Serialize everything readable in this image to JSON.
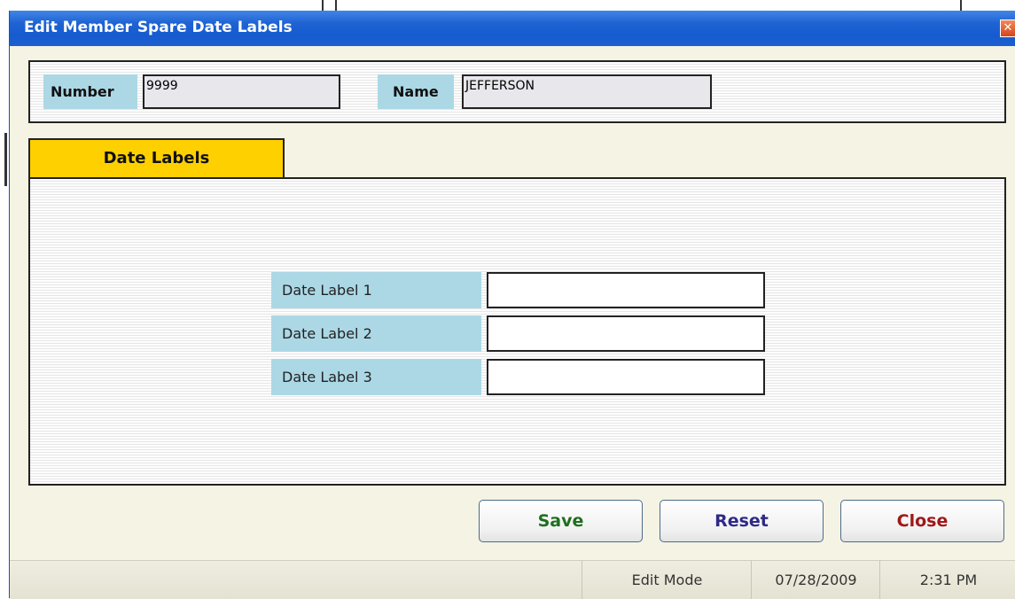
{
  "window": {
    "title": "Edit Member Spare Date Labels",
    "close_glyph": "✕"
  },
  "header": {
    "number_label": "Number",
    "number_value": "9999",
    "name_label": "Name",
    "name_value": "JEFFERSON"
  },
  "tabs": [
    {
      "label": "Date Labels",
      "active": true
    }
  ],
  "fields": [
    {
      "label": "Date Label 1",
      "value": ""
    },
    {
      "label": "Date Label 2",
      "value": ""
    },
    {
      "label": "Date Label 3",
      "value": ""
    }
  ],
  "buttons": {
    "save": "Save",
    "reset": "Reset",
    "close": "Close"
  },
  "status": {
    "mode": "Edit Mode",
    "date": "07/28/2009",
    "time": "2:31 PM"
  },
  "colors": {
    "titlebar": "#1f63d3",
    "tab_active": "#ffd000",
    "label_bg": "#acd8e6",
    "save": "#1f6e1f",
    "reset": "#2e2a86",
    "close": "#a01818"
  }
}
